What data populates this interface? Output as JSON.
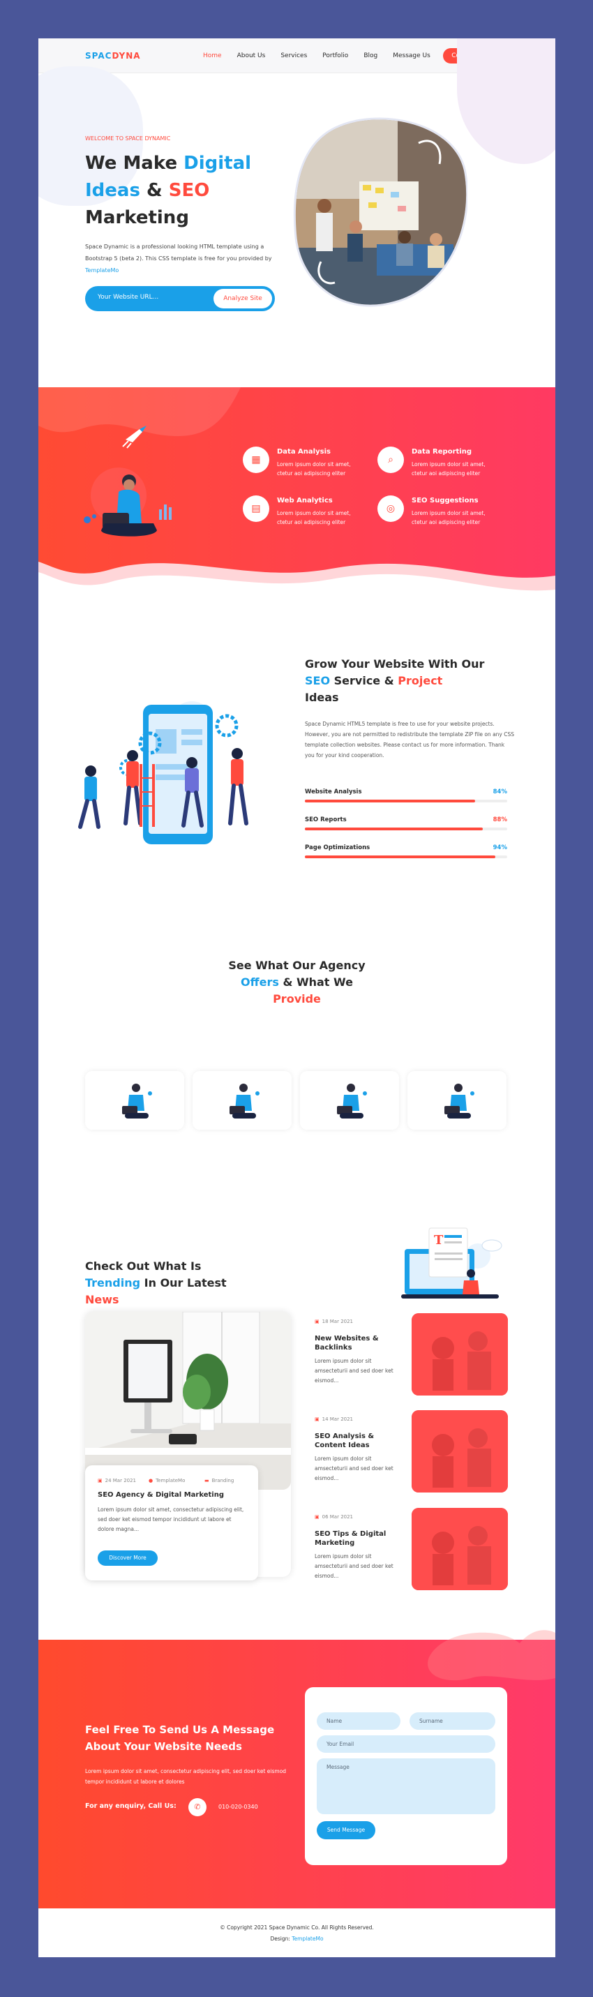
{
  "brand": {
    "part1": "SPAC",
    "part2": "DYNA"
  },
  "nav": {
    "items": [
      "Home",
      "About Us",
      "Services",
      "Portfolio",
      "Blog",
      "Message Us"
    ],
    "cta": "Contact Now"
  },
  "hero": {
    "eyebrow": "WELCOME TO SPACE DYNAMIC",
    "title_1": "We Make ",
    "title_2": "Digital",
    "title_3": "Ideas",
    "title_4": " & ",
    "title_5": "SEO",
    "title_6": "Marketing",
    "desc": "Space Dynamic is a professional looking HTML template using a Bootstrap 5 (beta 2). This CSS template is free for you provided by ",
    "desc_link": "TemplateMo",
    "search_placeholder": "Your Website URL...",
    "search_button": "Analyze Site"
  },
  "features": [
    {
      "icon": "chart-icon",
      "title": "Data Analysis",
      "desc": "Lorem ipsum dolor sit amet, ctetur aoi adipiscing eliter"
    },
    {
      "icon": "magnifier-icon",
      "title": "Data Reporting",
      "desc": "Lorem ipsum dolor sit amet, ctetur aoi adipiscing eliter"
    },
    {
      "icon": "browser-icon",
      "title": "Web Analytics",
      "desc": "Lorem ipsum dolor sit amet, ctetur aoi adipiscing eliter"
    },
    {
      "icon": "seo-icon",
      "title": "SEO Suggestions",
      "desc": "Lorem ipsum dolor sit amet, ctetur aoi adipiscing eliter"
    }
  ],
  "grow": {
    "title_1": "Grow Your Website With Our ",
    "title_2": "SEO",
    "title_3": " Service & ",
    "title_4": "Project",
    "title_5": "Ideas",
    "desc": "Space Dynamic HTML5 template is free to use for your website projects. However, you are not permitted to redistribute the template ZIP file on any CSS template collection websites. Please contact us for more information. Thank you for your kind cooperation.",
    "bars": [
      {
        "label": "Website Analysis",
        "value": "84%",
        "pct": 84
      },
      {
        "label": "SEO Reports",
        "value": "88%",
        "pct": 88
      },
      {
        "label": "Page Optimizations",
        "value": "94%",
        "pct": 94
      }
    ]
  },
  "offers": {
    "title_1": "See What Our Agency",
    "title_2": "Offers",
    "title_3": " & What We",
    "title_4": "Provide"
  },
  "news": {
    "title_1": "Check Out What Is",
    "title_2": "Trending",
    "title_3": " In Our Latest",
    "title_4": "News",
    "featured": {
      "date": "24 Mar 2021",
      "author": "TemplateMo",
      "category": "Branding",
      "title": "SEO Agency & Digital Marketing",
      "desc": "Lorem ipsum dolor sit amet, consectetur adipiscing elit, sed doer ket eismod tempor incididunt ut labore et dolore magna...",
      "button": "Discover More"
    },
    "items": [
      {
        "date": "18 Mar 2021",
        "title": "New Websites & Backlinks",
        "desc": "Lorem ipsum dolor sit amsecteturii and sed doer ket eismod..."
      },
      {
        "date": "14 Mar 2021",
        "title": "SEO Analysis & Content Ideas",
        "desc": "Lorem ipsum dolor sit amsecteturii and sed doer ket eismod..."
      },
      {
        "date": "06 Mar 2021",
        "title": "SEO Tips & Digital Marketing",
        "desc": "Lorem ipsum dolor sit amsecteturii and sed doer ket eismod..."
      }
    ]
  },
  "contact": {
    "title_1": "Feel Free To Send Us A Message",
    "title_2": "About Your Website Needs",
    "desc": "Lorem ipsum dolor sit amet, consectetur adipiscing elit, sed doer ket eismod tempor incididunt ut labore et dolores",
    "call_label": "For any enquiry, Call Us:",
    "phone": "010-020-0340",
    "form": {
      "name": "Name",
      "surname": "Surname",
      "email": "Your Email",
      "message": "Message",
      "send": "Send Message"
    }
  },
  "footer": {
    "copyright": "© Copyright 2021 Space Dynamic Co. All Rights Reserved.",
    "design_label": "Design: ",
    "design_link": "TemplateMo"
  },
  "colors": {
    "blue": "#1aa0e8",
    "red": "#ff4a3d",
    "frame": "#4a5699"
  }
}
